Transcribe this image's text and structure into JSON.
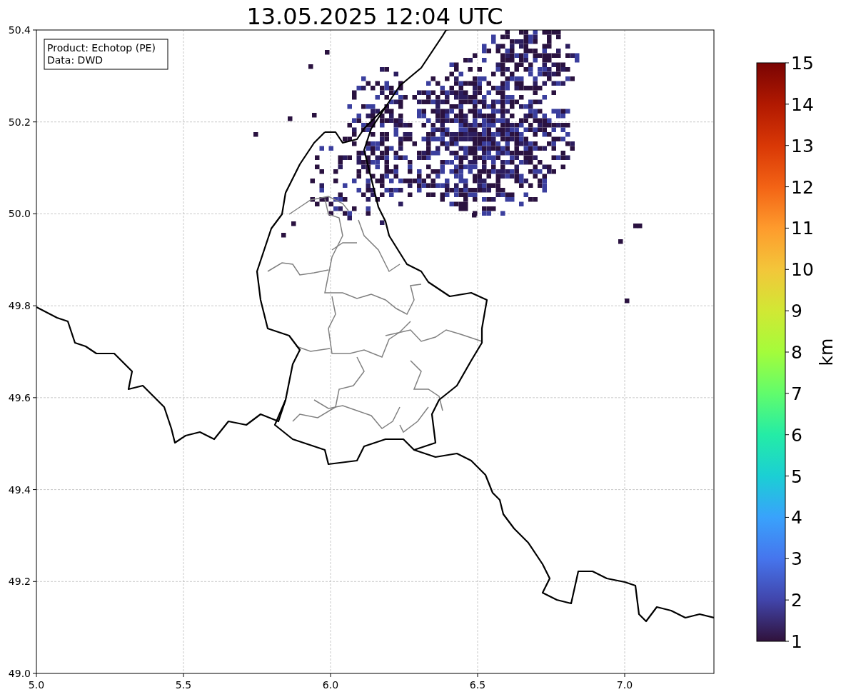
{
  "title": "13.05.2025 12:04 UTC",
  "info_box": {
    "lines": [
      "Product: Echotop (PE)",
      "Data: DWD"
    ]
  },
  "map": {
    "xticks": [
      "5.0",
      "5.5",
      "6.0",
      "6.5",
      "7.0"
    ],
    "yticks": [
      "50.4",
      "50.2",
      "50.0",
      "49.8",
      "49.6",
      "49.4",
      "49.2",
      "49.0"
    ]
  },
  "colorbar": {
    "label": "km",
    "ticks": [
      "15",
      "14",
      "13",
      "12",
      "11",
      "10",
      "9",
      "8",
      "7",
      "6",
      "5",
      "4",
      "3",
      "2",
      "1"
    ]
  }
}
